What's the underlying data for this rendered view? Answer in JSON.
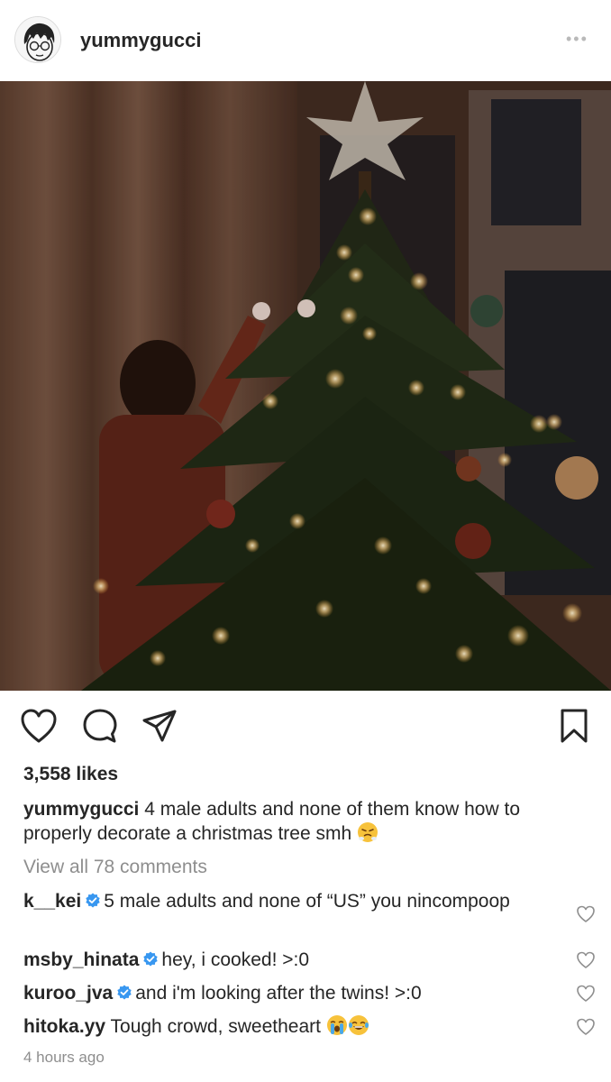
{
  "post": {
    "username": "yummygucci",
    "more_label": "•••",
    "likes": "3,558 likes",
    "caption": {
      "username": "yummygucci",
      "text": "4 male adults and none of them know how to properly decorate a christmas tree smh",
      "emoji": "huffing-face-emoji"
    },
    "view_all_comments": "View all 78 comments",
    "comments": [
      {
        "username": "k__kei",
        "verified": true,
        "text": "5 male adults and none of “US” you nincompoop"
      },
      {
        "username": "msby_hinata",
        "verified": true,
        "text": "hey, i cooked! >:0"
      },
      {
        "username": "kuroo_jva",
        "verified": true,
        "text": "and i'm looking after the twins! >:0"
      },
      {
        "username": "hitoka.yy",
        "verified": false,
        "text": "Tough crowd, sweetheart",
        "emoji": [
          "loudly-crying-face-emoji",
          "tears-of-joy-emoji"
        ]
      }
    ],
    "timestamp": "4 hours ago"
  },
  "icons": {
    "like": "heart-icon",
    "comment": "comment-bubble-icon",
    "share": "paper-plane-icon",
    "save": "bookmark-icon",
    "verified": "verified-badge-icon",
    "comment_like": "small-heart-icon"
  },
  "colors": {
    "text": "#262626",
    "secondary": "#8e8e8e",
    "verified": "#3897f0"
  }
}
